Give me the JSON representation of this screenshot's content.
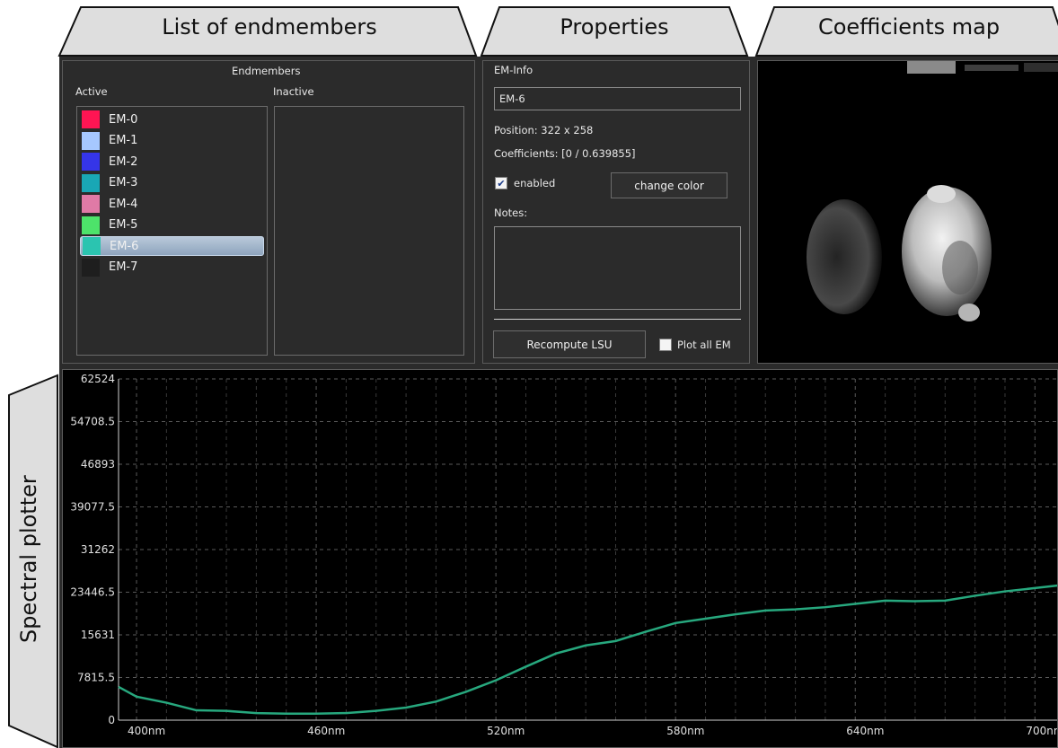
{
  "tabs": {
    "list": "List of endmembers",
    "properties": "Properties",
    "coeffs": "Coefficients map",
    "plotter": "Spectral plotter"
  },
  "endmembers": {
    "group_title": "Endmembers",
    "active_label": "Active",
    "inactive_label": "Inactive",
    "items": [
      {
        "label": "EM-0",
        "color": "#ff1553"
      },
      {
        "label": "EM-1",
        "color": "#a6c8ff"
      },
      {
        "label": "EM-2",
        "color": "#3535e8"
      },
      {
        "label": "EM-3",
        "color": "#19a7b5"
      },
      {
        "label": "EM-4",
        "color": "#e07aa6"
      },
      {
        "label": "EM-5",
        "color": "#4de36a"
      },
      {
        "label": "EM-6",
        "color": "#2bc4b0"
      },
      {
        "label": "EM-7",
        "color": "#1e1e1e"
      }
    ],
    "selected_index": 6
  },
  "em_info": {
    "group_title": "EM-Info",
    "name_value": "EM-6",
    "position_text": "Position: 322 x 258",
    "coefficients_text": "Coefficients: [0 / 0.639855]",
    "enabled_label": "enabled",
    "enabled_checked": true,
    "change_color_label": "change color",
    "notes_label": "Notes:",
    "notes_value": "",
    "recompute_label": "Recompute LSU",
    "plot_all_label": "Plot all EM",
    "plot_all_checked": false
  },
  "chart_data": {
    "type": "line",
    "title": "",
    "xlabel": "",
    "ylabel": "",
    "y_ticks": [
      "62524",
      "54708.5",
      "46893",
      "39077.5",
      "31262",
      "23446.5",
      "15631",
      "7815.5",
      "0"
    ],
    "x_ticks": [
      "400nm",
      "460nm",
      "520nm",
      "580nm",
      "640nm",
      "700nm"
    ],
    "ylim": [
      0,
      62524
    ],
    "xlim": [
      394,
      708
    ],
    "grid": true,
    "series": [
      {
        "color": "#27a87e",
        "x": [
          394,
          400,
          410,
          420,
          430,
          440,
          450,
          460,
          470,
          480,
          490,
          500,
          510,
          520,
          530,
          540,
          550,
          560,
          570,
          580,
          590,
          600,
          610,
          620,
          630,
          640,
          650,
          660,
          670,
          680,
          690,
          700,
          708
        ],
        "values": [
          6100,
          4300,
          3200,
          1800,
          1700,
          1300,
          1200,
          1200,
          1300,
          1700,
          2300,
          3400,
          5200,
          7300,
          9800,
          12200,
          13700,
          14500,
          16200,
          17800,
          18600,
          19400,
          20100,
          20300,
          20700,
          21300,
          21900,
          21800,
          21900,
          22800,
          23600,
          24200,
          24700
        ]
      }
    ]
  }
}
